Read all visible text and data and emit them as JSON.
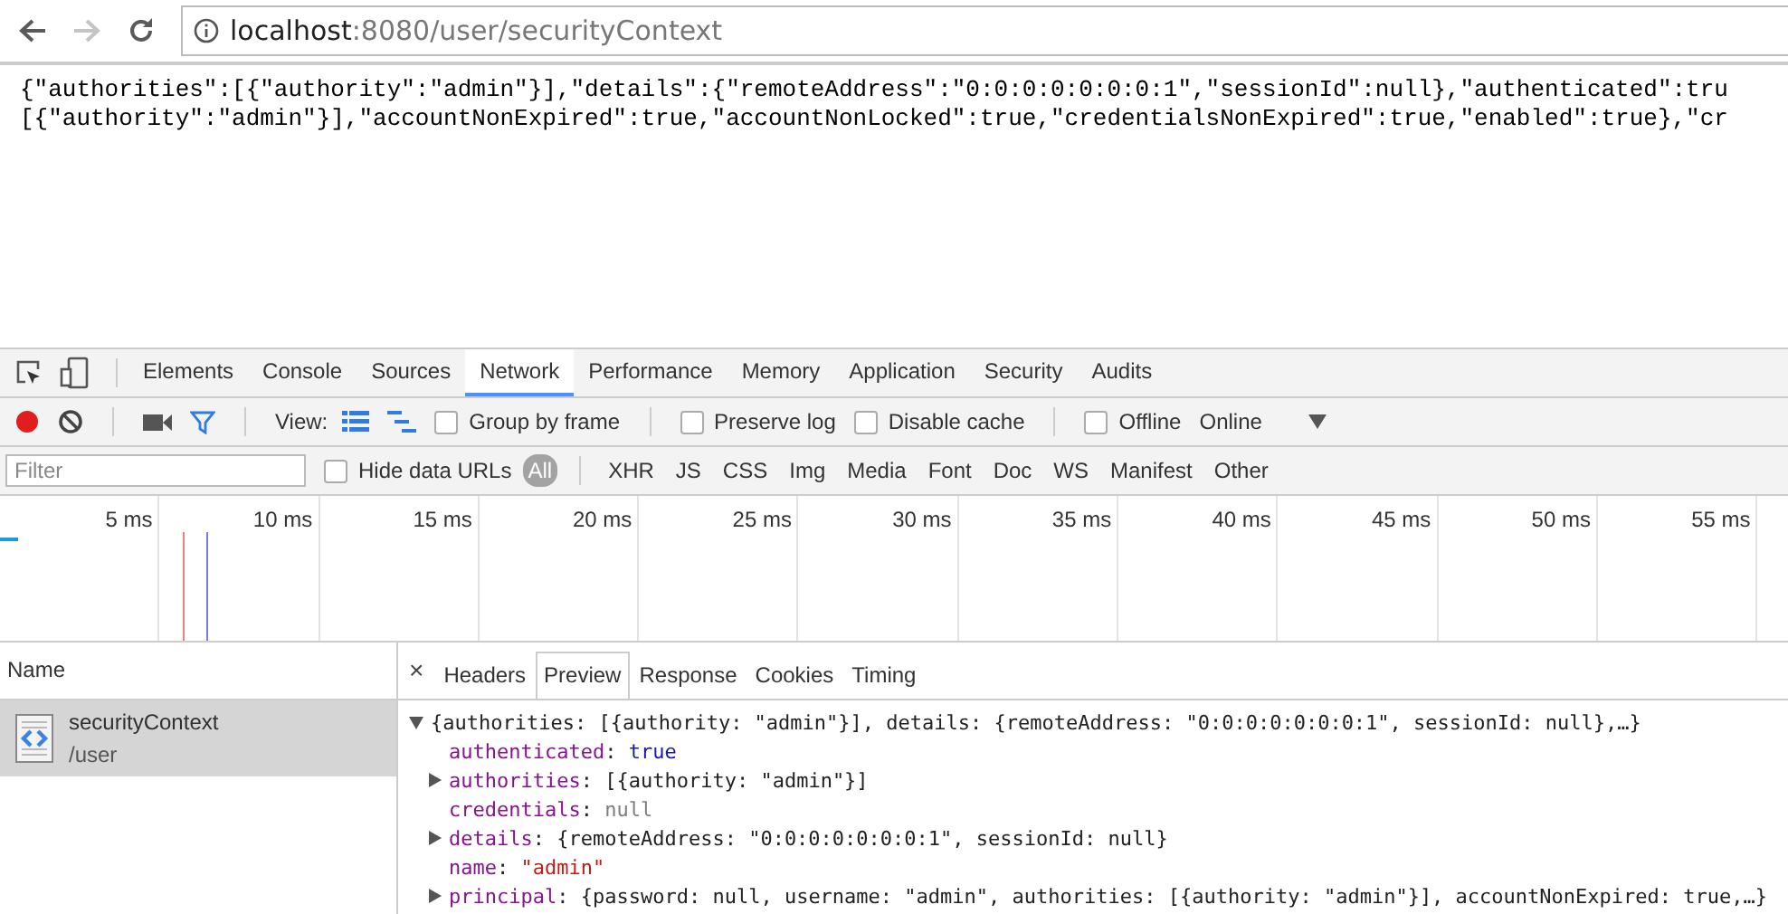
{
  "browser": {
    "url_host": "localhost",
    "url_rest": ":8080/user/securityContext"
  },
  "page_body": {
    "lines": [
      "{\"authorities\":[{\"authority\":\"admin\"}],\"details\":{\"remoteAddress\":\"0:0:0:0:0:0:0:1\",\"sessionId\":null},\"authenticated\":tru",
      "[{\"authority\":\"admin\"}],\"accountNonExpired\":true,\"accountNonLocked\":true,\"credentialsNonExpired\":true,\"enabled\":true},\"cr"
    ]
  },
  "devtools": {
    "tabs": [
      {
        "label": "Elements",
        "selected": false
      },
      {
        "label": "Console",
        "selected": false
      },
      {
        "label": "Sources",
        "selected": false
      },
      {
        "label": "Network",
        "selected": true
      },
      {
        "label": "Performance",
        "selected": false
      },
      {
        "label": "Memory",
        "selected": false
      },
      {
        "label": "Application",
        "selected": false
      },
      {
        "label": "Security",
        "selected": false
      },
      {
        "label": "Audits",
        "selected": false
      }
    ],
    "toolbar": {
      "recording": true,
      "filter_on": true,
      "view_label": "View:",
      "options": [
        {
          "label": "Group by frame",
          "checked": false
        },
        {
          "label": "Preserve log",
          "checked": false
        },
        {
          "label": "Disable cache",
          "checked": false
        },
        {
          "label": "Offline",
          "checked": false
        }
      ],
      "throttling": "Online"
    },
    "filter_bar": {
      "placeholder": "Filter",
      "hide_data_urls": {
        "label": "Hide data URLs",
        "checked": false
      },
      "types": [
        {
          "label": "All",
          "selected": true
        },
        {
          "label": "XHR",
          "selected": false
        },
        {
          "label": "JS",
          "selected": false
        },
        {
          "label": "CSS",
          "selected": false
        },
        {
          "label": "Img",
          "selected": false
        },
        {
          "label": "Media",
          "selected": false
        },
        {
          "label": "Font",
          "selected": false
        },
        {
          "label": "Doc",
          "selected": false
        },
        {
          "label": "WS",
          "selected": false
        },
        {
          "label": "Manifest",
          "selected": false
        },
        {
          "label": "Other",
          "selected": false
        }
      ]
    },
    "timeline": {
      "ticks": [
        "5 ms",
        "10 ms",
        "15 ms",
        "20 ms",
        "25 ms",
        "30 ms",
        "35 ms",
        "40 ms",
        "45 ms",
        "50 ms",
        "55 ms"
      ]
    },
    "requests": {
      "header": "Name",
      "rows": [
        {
          "name": "securityContext",
          "path": "/user",
          "selected": true
        }
      ]
    },
    "detail_tabs": [
      {
        "label": "Headers",
        "selected": false
      },
      {
        "label": "Preview",
        "selected": true
      },
      {
        "label": "Response",
        "selected": false
      },
      {
        "label": "Cookies",
        "selected": false
      },
      {
        "label": "Timing",
        "selected": false
      }
    ],
    "close_label": "×",
    "preview": {
      "separator": ":",
      "summary": "{authorities: [{authority: \"admin\"}], details: {remoteAddress: \"0:0:0:0:0:0:0:1\", sessionId: null},…}",
      "expanded": true,
      "properties": [
        {
          "key": "authenticated",
          "value": "true",
          "kind": "boolean",
          "expandable": false
        },
        {
          "key": "authorities",
          "value": "[{authority: \"admin\"}]",
          "kind": "object",
          "expandable": true
        },
        {
          "key": "credentials",
          "value": "null",
          "kind": "null",
          "expandable": false
        },
        {
          "key": "details",
          "value": "{remoteAddress: \"0:0:0:0:0:0:0:1\", sessionId: null}",
          "kind": "object",
          "expandable": true
        },
        {
          "key": "name",
          "value": "\"admin\"",
          "kind": "string",
          "expandable": false
        },
        {
          "key": "principal",
          "value": "{password: null, username: \"admin\", authorities: [{authority: \"admin\"}], accountNonExpired: true,…}",
          "kind": "object",
          "expandable": true
        }
      ]
    }
  }
}
